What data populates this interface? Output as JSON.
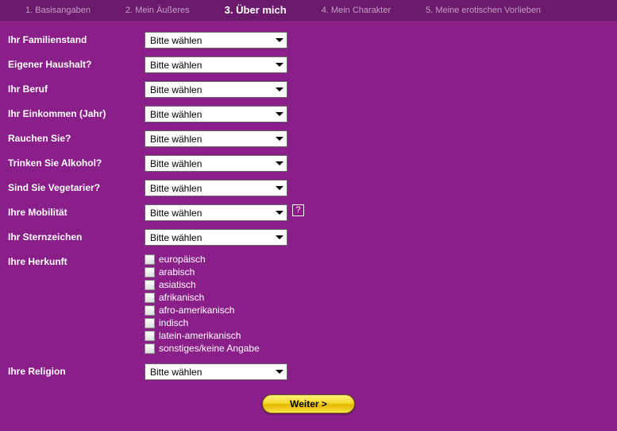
{
  "tabs": [
    {
      "label": "1. Basisangaben",
      "active": false
    },
    {
      "label": "2. Mein Äußeres",
      "active": false
    },
    {
      "label": "3. Über mich",
      "active": true
    },
    {
      "label": "4. Mein Charakter",
      "active": false
    },
    {
      "label": "5. Meine erotischen Vorlieben",
      "active": false
    }
  ],
  "placeholder": "Bitte wählen",
  "help_glyph": "?",
  "fields": {
    "familienstand": {
      "label": "Ihr Familienstand"
    },
    "haushalt": {
      "label": "Eigener Haushalt?"
    },
    "beruf": {
      "label": "Ihr Beruf"
    },
    "einkommen": {
      "label": "Ihr Einkommen (Jahr)"
    },
    "rauchen": {
      "label": "Rauchen Sie?"
    },
    "alkohol": {
      "label": "Trinken Sie Alkohol?"
    },
    "vegetarier": {
      "label": "Sind Sie Vegetarier?"
    },
    "mobilitaet": {
      "label": "Ihre Mobilität"
    },
    "sternzeichen": {
      "label": "Ihr Sternzeichen"
    },
    "herkunft": {
      "label": "Ihre Herkunft"
    },
    "religion": {
      "label": "Ihre Religion"
    }
  },
  "herkunft_options": [
    "europäisch",
    "arabisch",
    "asiatisch",
    "afrikanisch",
    "afro-amerikanisch",
    "indisch",
    "latein-amerikanisch",
    "sonstiges/keine Angabe"
  ],
  "buttons": {
    "weiter": "Weiter >"
  }
}
